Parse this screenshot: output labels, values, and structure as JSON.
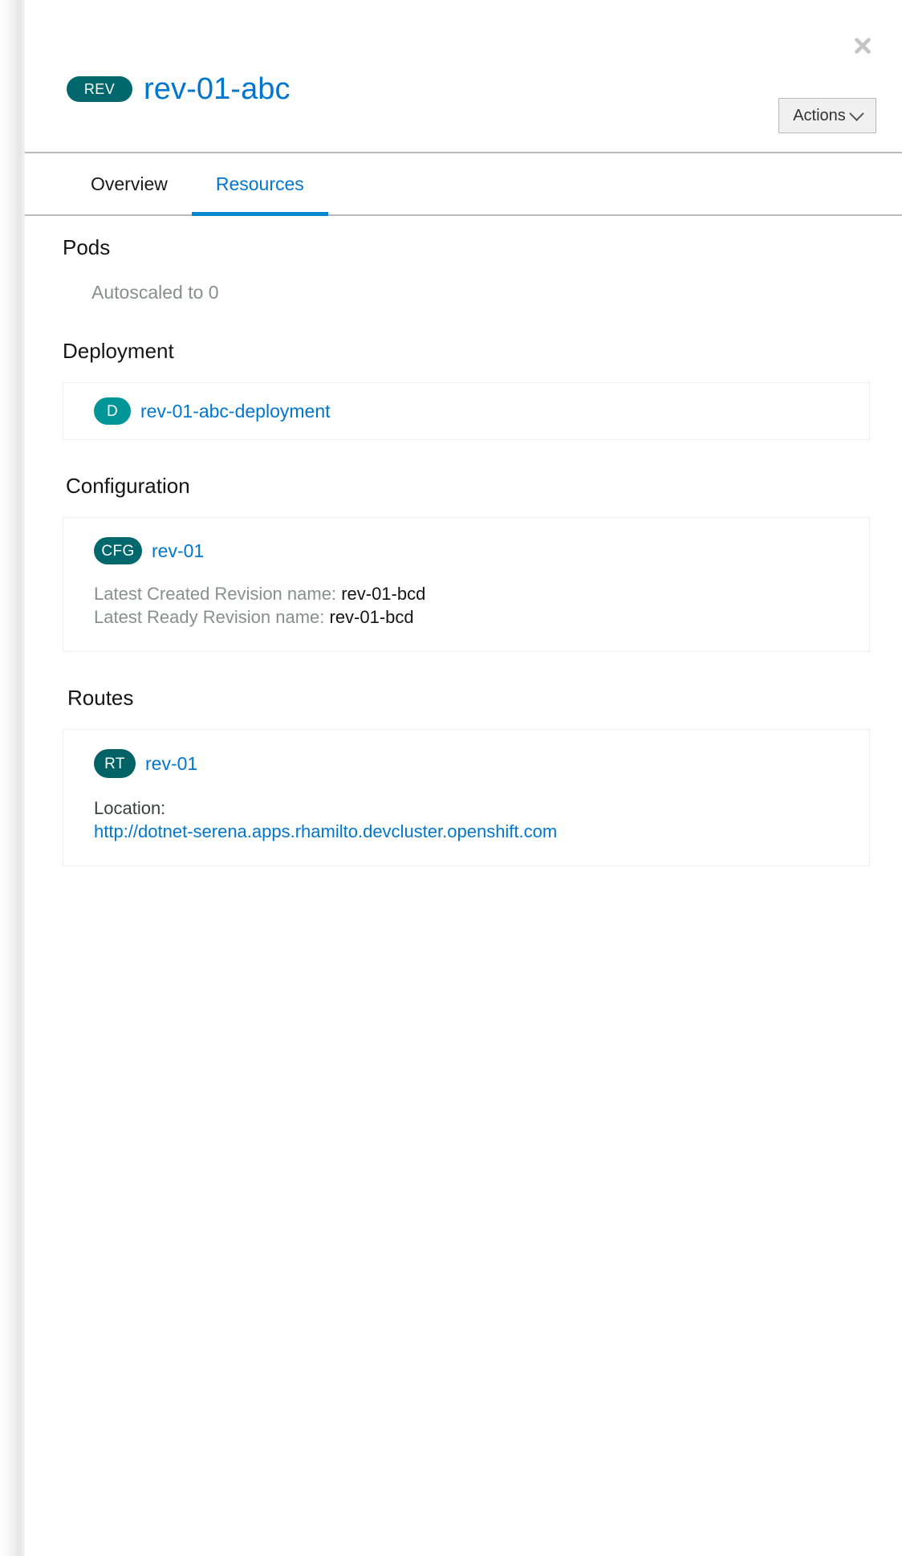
{
  "drawer": {
    "close_label": "×",
    "header": {
      "badge": "REV",
      "title": "rev-01-abc",
      "actions_label": "Actions"
    },
    "tabs": [
      {
        "label": "Overview",
        "active": false
      },
      {
        "label": "Resources",
        "active": true
      }
    ]
  },
  "resources": {
    "pods": {
      "title": "Pods",
      "status": "Autoscaled to 0"
    },
    "deployment": {
      "title": "Deployment",
      "badge": "D",
      "name": "rev-01-abc-deployment"
    },
    "configuration": {
      "title": "Configuration",
      "badge": "CFG",
      "name": "rev-01",
      "details": [
        {
          "label": "Latest Created Revision name:",
          "value": "rev-01-bcd"
        },
        {
          "label": "Latest Ready Revision name:",
          "value": "rev-01-bcd"
        }
      ]
    },
    "routes": {
      "title": "Routes",
      "badge": "RT",
      "name": "rev-01",
      "location_label": "Location:",
      "location_url": "http://dotnet-serena.apps.rhamilto.devcluster.openshift.com"
    }
  },
  "colors": {
    "badge_dark_teal": "#00686c",
    "badge_light_teal": "#009596",
    "link_blue": "#0076cf",
    "tab_active_blue": "#0088ce",
    "muted_text": "#8a8d90"
  }
}
